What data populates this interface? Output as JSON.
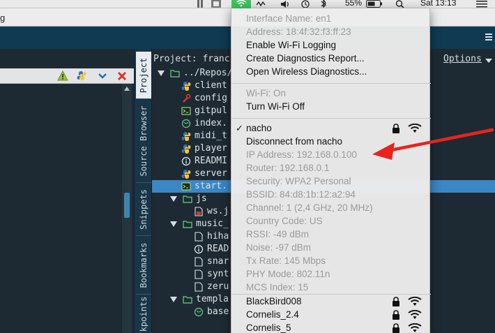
{
  "menubar": {
    "battery_percent": "55%",
    "clock": "Sat 13:13",
    "icons": [
      "app-icon",
      "app-icon",
      "wifi-icon",
      "wave-icon",
      "volume-icon",
      "time-machine-icon",
      "bluetooth-icon",
      "battery-icon",
      "search-icon",
      "notification-center-icon"
    ]
  },
  "titlestrip": {
    "text": "g"
  },
  "editor": {
    "icons": [
      "warning-icon",
      "python-icon",
      "chevron-down-icon",
      "close-icon"
    ]
  },
  "vtabs": [
    "Project",
    "Source Browser",
    "Snippets",
    "Bookmarks",
    "kpoints"
  ],
  "project": {
    "title": "Project: franc",
    "options": "Options",
    "rows": [
      {
        "label": "../Repos/",
        "icon": "folder-icon",
        "expanded": true
      },
      {
        "label": "client",
        "icon": "python-icon"
      },
      {
        "label": "config",
        "icon": "tools-icon"
      },
      {
        "label": "gitpul",
        "icon": "shell-icon"
      },
      {
        "label": "index.",
        "icon": "web-icon"
      },
      {
        "label": "midi_t",
        "icon": "python-icon"
      },
      {
        "label": "player",
        "icon": "python-icon"
      },
      {
        "label": "READMI",
        "icon": "info-icon"
      },
      {
        "label": "server",
        "icon": "python-icon"
      },
      {
        "label": "start.",
        "icon": "shell-icon",
        "selected": true
      },
      {
        "label": "js",
        "icon": "folder-icon",
        "expanded": true
      },
      {
        "label": "ws.j",
        "icon": "js-icon"
      },
      {
        "label": "music_",
        "icon": "folder-icon",
        "expanded": true
      },
      {
        "label": "hiha",
        "icon": "file-icon"
      },
      {
        "label": "READ",
        "icon": "info-icon"
      },
      {
        "label": "snar",
        "icon": "file-icon"
      },
      {
        "label": "synt",
        "icon": "file-icon"
      },
      {
        "label": "zeru",
        "icon": "file-icon"
      },
      {
        "label": "templa",
        "icon": "folder-icon",
        "expanded": true
      },
      {
        "label": "base",
        "icon": "web-icon"
      }
    ]
  },
  "wifi_menu": {
    "interface_name": "Interface Name: en1",
    "address": "Address: 18:4f:32:f3:ff:23",
    "enable_logging": "Enable Wi-Fi Logging",
    "create_report": "Create Diagnostics Report...",
    "open_diagnostics": "Open Wireless Diagnostics...",
    "wifi_status": "Wi-Fi: On",
    "turn_off": "Turn Wi-Fi Off",
    "connected_network": "nacho",
    "check": "✓",
    "disconnect": "Disconnect from nacho",
    "details": [
      "IP Address: 192.168.0.100",
      "Router: 192.168.0.1",
      "Security: WPA2 Personal",
      "BSSID: 84:d8:1b:12:a2:94",
      "Channel: 1 (2,4 GHz, 20 MHz)",
      "Country Code: US",
      "RSSI: -49 dBm",
      "Noise: -97 dBm",
      "Tx Rate: 145 Mbps",
      "PHY Mode: 802.11n",
      "MCS Index: 15"
    ],
    "other_networks": [
      "BlackBird008",
      "Cornelis_2.4",
      "Cornelis_5"
    ]
  },
  "colors": {
    "wifi_active": "#3ec45f",
    "annotation_arrow": "#e8241c",
    "selection": "#3b86c4",
    "ide_header": "#0f3a52"
  }
}
